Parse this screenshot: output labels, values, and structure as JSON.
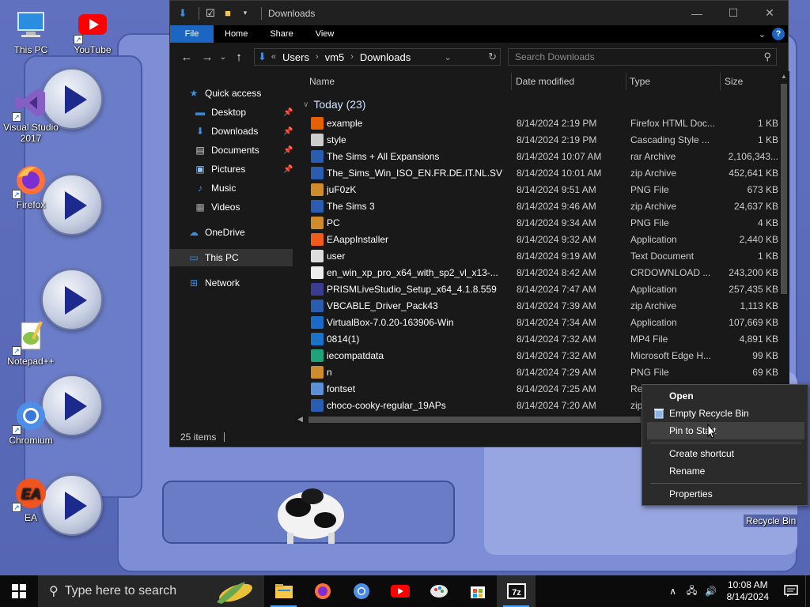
{
  "desktop": {
    "icons": [
      {
        "label": "This PC",
        "icon": "this-pc-icon"
      },
      {
        "label": "YouTube",
        "icon": "youtube-icon"
      },
      {
        "label": "Visual Studio 2017",
        "icon": "visual-studio-icon"
      },
      {
        "label": "Firefox",
        "icon": "firefox-icon"
      },
      {
        "label": "Notepad++",
        "icon": "notepad-plus-plus-icon"
      },
      {
        "label": "Chromium",
        "icon": "chromium-icon"
      },
      {
        "label": "EA",
        "icon": "ea-icon"
      }
    ],
    "recycle_bin_label": "Recycle Bin"
  },
  "explorer": {
    "title": "Downloads",
    "ribbon_tabs": [
      "File",
      "Home",
      "Share",
      "View"
    ],
    "breadcrumb": [
      "Users",
      "vm5",
      "Downloads"
    ],
    "search_placeholder": "Search Downloads",
    "nav": {
      "quick_access": "Quick access",
      "items": [
        {
          "label": "Desktop",
          "icon": "desktop-folder-icon"
        },
        {
          "label": "Downloads",
          "icon": "downloads-folder-icon"
        },
        {
          "label": "Documents",
          "icon": "documents-folder-icon"
        },
        {
          "label": "Pictures",
          "icon": "pictures-folder-icon"
        },
        {
          "label": "Music",
          "icon": "music-folder-icon"
        },
        {
          "label": "Videos",
          "icon": "videos-folder-icon"
        }
      ],
      "onedrive": "OneDrive",
      "this_pc": "This PC",
      "network": "Network"
    },
    "columns": {
      "name": "Name",
      "date": "Date modified",
      "type": "Type",
      "size": "Size"
    },
    "group_label": "Today (23)",
    "files": [
      {
        "name": "example",
        "date": "8/14/2024 2:19 PM",
        "type": "Firefox HTML Doc...",
        "size": "1 KB",
        "icon": "firefox-html-icon",
        "color": "#e66000"
      },
      {
        "name": "style",
        "date": "8/14/2024 2:19 PM",
        "type": "Cascading Style ...",
        "size": "1 KB",
        "icon": "css-file-icon",
        "color": "#cccccc"
      },
      {
        "name": "The Sims + All Expansions",
        "date": "8/14/2024 10:07 AM",
        "type": "rar Archive",
        "size": "2,106,343...",
        "icon": "rar-archive-icon",
        "color": "#2a5db0"
      },
      {
        "name": "The_Sims_Win_ISO_EN.FR.DE.IT.NL.SV",
        "date": "8/14/2024 10:01 AM",
        "type": "zip Archive",
        "size": "452,641 KB",
        "icon": "zip-archive-icon",
        "color": "#2a5db0"
      },
      {
        "name": "juF0zK",
        "date": "8/14/2024 9:51 AM",
        "type": "PNG File",
        "size": "673 KB",
        "icon": "png-file-icon",
        "color": "#d08b2a"
      },
      {
        "name": "The Sims 3",
        "date": "8/14/2024 9:46 AM",
        "type": "zip Archive",
        "size": "24,637 KB",
        "icon": "zip-archive-icon",
        "color": "#2a5db0"
      },
      {
        "name": "PC",
        "date": "8/14/2024 9:34 AM",
        "type": "PNG File",
        "size": "4 KB",
        "icon": "png-file-icon",
        "color": "#d08b2a"
      },
      {
        "name": "EAappInstaller",
        "date": "8/14/2024 9:32 AM",
        "type": "Application",
        "size": "2,440 KB",
        "icon": "ea-app-icon",
        "color": "#f05a1a"
      },
      {
        "name": "user",
        "date": "8/14/2024 9:19 AM",
        "type": "Text Document",
        "size": "1 KB",
        "icon": "text-file-icon",
        "color": "#dddddd"
      },
      {
        "name": "en_win_xp_pro_x64_with_sp2_vl_x13-...",
        "date": "8/14/2024 8:42 AM",
        "type": "CRDOWNLOAD ...",
        "size": "243,200 KB",
        "icon": "blank-file-icon",
        "color": "#eeeeee"
      },
      {
        "name": "PRISMLiveStudio_Setup_x64_4.1.8.559",
        "date": "8/14/2024 7:47 AM",
        "type": "Application",
        "size": "257,435 KB",
        "icon": "prism-app-icon",
        "color": "#3b3b8f"
      },
      {
        "name": "VBCABLE_Driver_Pack43",
        "date": "8/14/2024 7:39 AM",
        "type": "zip Archive",
        "size": "1,113 KB",
        "icon": "zip-archive-icon",
        "color": "#2a5db0"
      },
      {
        "name": "VirtualBox-7.0.20-163906-Win",
        "date": "8/14/2024 7:34 AM",
        "type": "Application",
        "size": "107,669 KB",
        "icon": "virtualbox-icon",
        "color": "#1b6ac9"
      },
      {
        "name": "0814(1)",
        "date": "8/14/2024 7:32 AM",
        "type": "MP4 File",
        "size": "4,891 KB",
        "icon": "mp4-file-icon",
        "color": "#1a73c8"
      },
      {
        "name": "iecompatdata",
        "date": "8/14/2024 7:32 AM",
        "type": "Microsoft Edge H...",
        "size": "99 KB",
        "icon": "edge-html-icon",
        "color": "#1fa37a"
      },
      {
        "name": "n",
        "date": "8/14/2024 7:29 AM",
        "type": "PNG File",
        "size": "69 KB",
        "icon": "png-file-icon",
        "color": "#d08b2a"
      },
      {
        "name": "fontset",
        "date": "8/14/2024 7:25 AM",
        "type": "Re",
        "size": "",
        "icon": "registry-file-icon",
        "color": "#5c8fd6"
      },
      {
        "name": "choco-cooky-regular_19APs",
        "date": "8/14/2024 7:20 AM",
        "type": "zip",
        "size": "",
        "icon": "zip-archive-icon",
        "color": "#2a5db0"
      }
    ],
    "status": "25 items"
  },
  "context_menu": {
    "items": [
      {
        "label": "Open",
        "bold": true
      },
      {
        "label": "Empty Recycle Bin",
        "icon": "recycle-bin-small-icon"
      },
      {
        "label": "Pin to Start"
      },
      {
        "label": "Create shortcut"
      },
      {
        "label": "Rename"
      },
      {
        "label": "Properties"
      }
    ]
  },
  "taskbar": {
    "search_placeholder": "Type here to search",
    "apps": [
      "file-explorer-icon",
      "firefox-icon",
      "chromium-icon",
      "youtube-icon",
      "paint-icon",
      "microsoft-store-icon",
      "7zip-icon"
    ],
    "time": "10:08 AM",
    "date": "8/14/2024"
  },
  "colors": {
    "accent": "#1a66c2",
    "window_bg": "#191919",
    "wallpaper": "#5a6cb6"
  }
}
